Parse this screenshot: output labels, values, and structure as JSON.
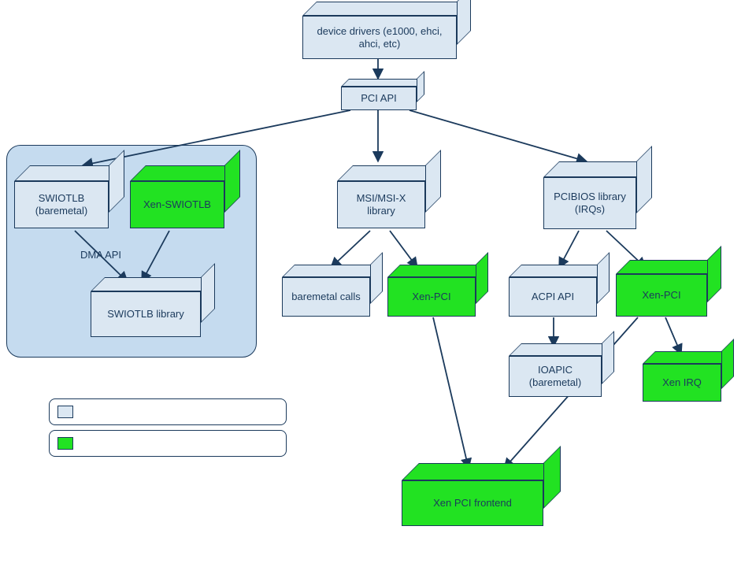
{
  "nodes": {
    "drivers": "device drivers (e1000, ehci, ahci, etc)",
    "pci_api": "PCI API",
    "swiotlb_bare": "SWIOTLB (baremetal)",
    "xen_swiotlb": "Xen-SWIOTLB",
    "swiotlb_lib": "SWIOTLB library",
    "dma_api": "DMA API",
    "msi": "MSI/MSI-X library",
    "pcibios": "PCIBIOS library (IRQs)",
    "baremetal_calls": "baremetal calls",
    "xen_pci_1": "Xen-PCI",
    "acpi": "ACPI API",
    "xen_pci_2": "Xen-PCI",
    "ioapic": "IOAPIC (baremetal)",
    "xen_irq": "Xen IRQ",
    "xen_pci_frontend": "Xen PCI frontend"
  },
  "legend": {
    "blue": "",
    "green": ""
  },
  "colors": {
    "stroke": "#1b3a5c",
    "blue_fill": "#dbe7f2",
    "green_fill": "#22e222",
    "panel_fill": "#c5dbef"
  }
}
